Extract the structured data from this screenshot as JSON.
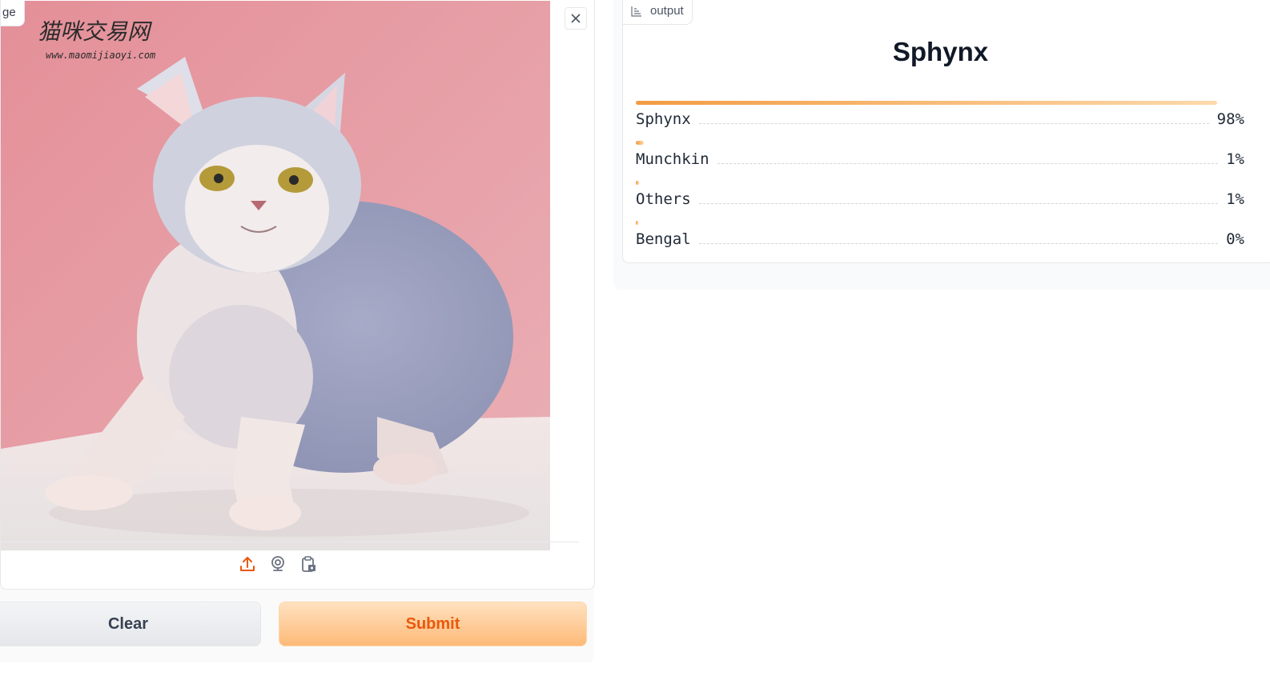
{
  "input": {
    "tab_label": "ge",
    "image": {
      "watermark_title": "猫咪交易网",
      "watermark_url": "www.maomijiaoyi.com"
    },
    "close_icon": "close-icon",
    "source_icons": [
      "upload-icon",
      "webcam-icon",
      "clipboard-icon"
    ]
  },
  "actions": {
    "clear_label": "Clear",
    "submit_label": "Submit"
  },
  "output": {
    "tab_label": "output",
    "tab_icon": "bar-chart-icon",
    "title": "Sphynx",
    "confidences": [
      {
        "label": "Sphynx",
        "percent_text": "98%",
        "value": 0.98
      },
      {
        "label": "Munchkin",
        "percent_text": "1%",
        "value": 0.013
      },
      {
        "label": "Others",
        "percent_text": "1%",
        "value": 0.005
      },
      {
        "label": "Bengal",
        "percent_text": "0%",
        "value": 0.003
      }
    ]
  },
  "colors": {
    "accent_orange": "#ea580c",
    "bar_start": "#f29c43",
    "bar_end": "#fcd9ac",
    "background_pink": "#e8a0a8"
  }
}
